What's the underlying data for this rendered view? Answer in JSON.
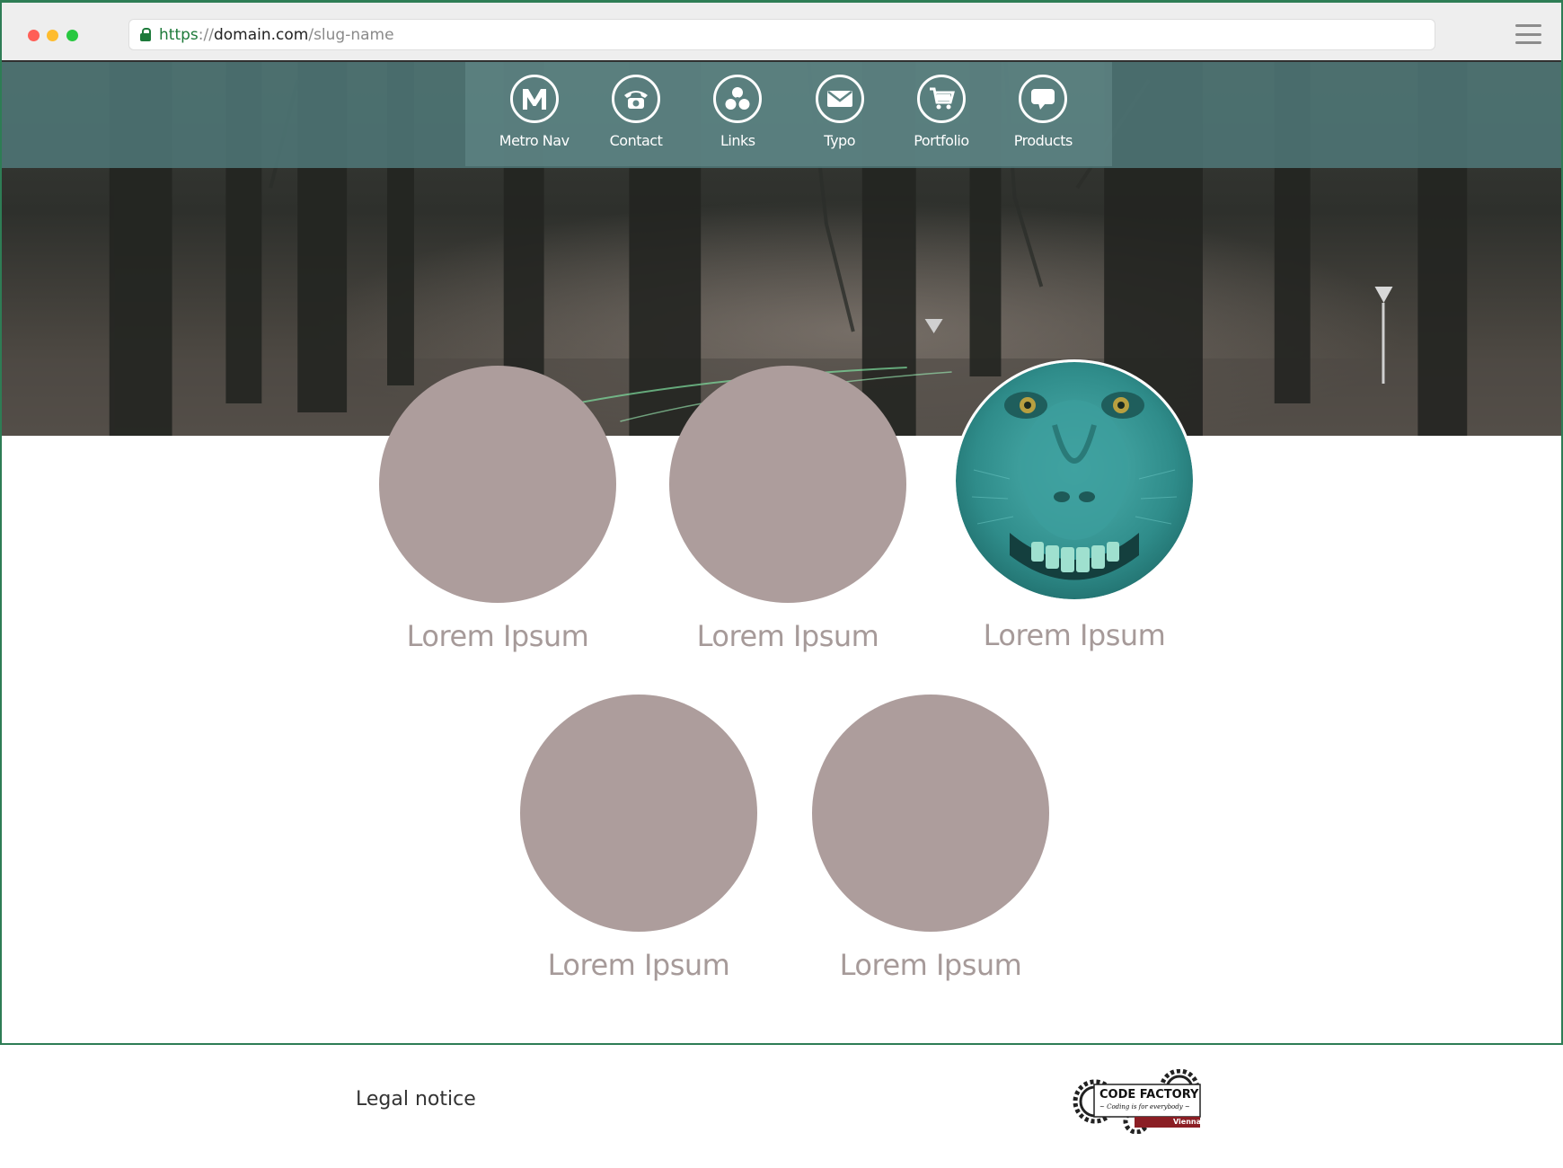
{
  "browser": {
    "url_scheme": "https",
    "url_separator": "://",
    "url_domain": "domain.com",
    "url_path": "/slug-name"
  },
  "nav": {
    "items": [
      {
        "label": "Metro Nav",
        "icon": "metro-m-icon"
      },
      {
        "label": "Contact",
        "icon": "telephone-icon"
      },
      {
        "label": "Links",
        "icon": "links-icon"
      },
      {
        "label": "Typo",
        "icon": "envelope-icon"
      },
      {
        "label": "Portfolio",
        "icon": "shopping-cart-icon"
      },
      {
        "label": "Products",
        "icon": "speech-bubble-icon"
      }
    ]
  },
  "tiles": [
    {
      "label": "Lorem Ipsum",
      "image": "none"
    },
    {
      "label": "Lorem Ipsum",
      "image": "none"
    },
    {
      "label": "Lorem Ipsum",
      "image": "monkey-face-teal"
    },
    {
      "label": "Lorem Ipsum",
      "image": "none"
    },
    {
      "label": "Lorem Ipsum",
      "image": "none"
    }
  ],
  "footer": {
    "legal_label": "Legal notice",
    "logo_title": "CODE FACTORY",
    "logo_tagline": "~ Coding is for everybody ~",
    "logo_city": "Vienna"
  },
  "colors": {
    "nav_band": "#4e7676",
    "tile_circle": "#ad9d9c",
    "tile_label": "#a69a99",
    "browser_border": "#2e7d55",
    "url_scheme": "#1d7a3a"
  }
}
